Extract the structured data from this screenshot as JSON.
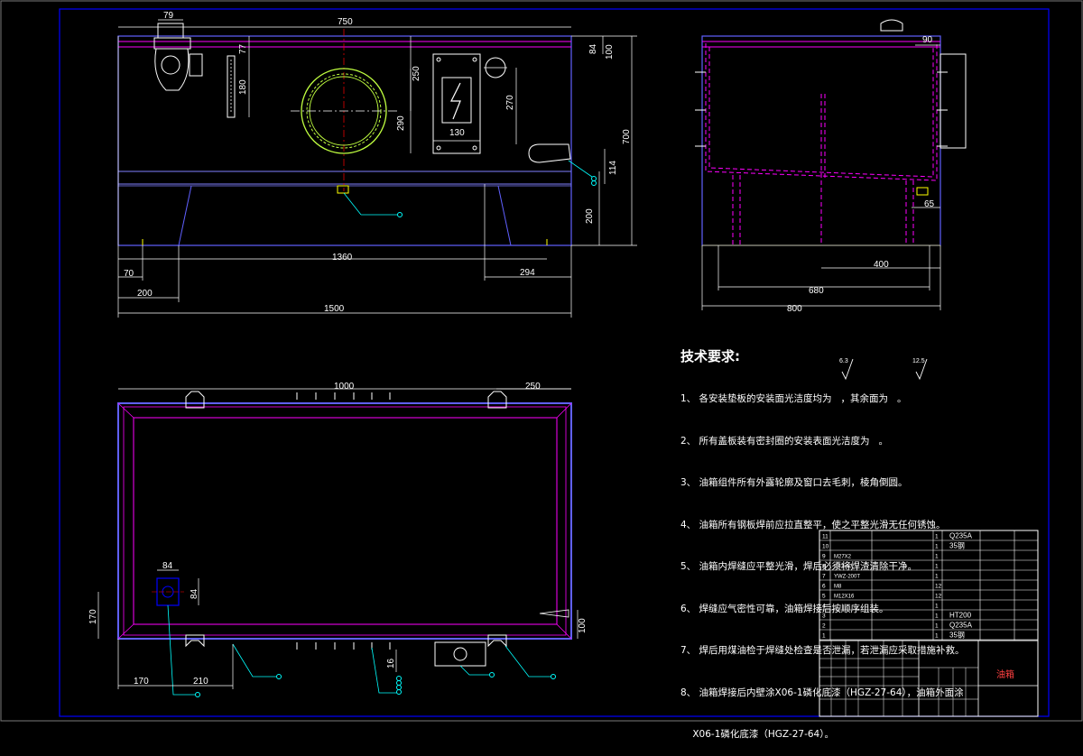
{
  "dimensions": {
    "front": [
      "79",
      "750",
      "84",
      "100",
      "77",
      "250",
      "180",
      "290",
      "270",
      "130",
      "700",
      "114",
      "200",
      "1360",
      "70",
      "294",
      "200",
      "1500"
    ],
    "side": [
      "90",
      "65",
      "400",
      "680",
      "800"
    ],
    "plan": [
      "1000",
      "250",
      "84",
      "84",
      "170",
      "100",
      "170",
      "210",
      "16"
    ]
  },
  "tech": {
    "title": "技术要求:",
    "items": [
      "1、 各安装垫板的安装面光洁度均为   ，其余面为   。",
      "2、 所有盖板装有密封圈的安装表面光洁度为   。",
      "3、 油箱组件所有外露轮廓及窗口去毛刺，棱角倒圆。",
      "4、 油箱所有钢板焊前应拉直整平，使之平整光滑无任何锈蚀。",
      "5、 油箱内焊缝应平整光滑，焊后必须将焊渣清除干净。",
      "6、 焊缝应气密性可靠，油箱焊接后按顺序组装。",
      "7、 焊后用煤油检于焊缝处检查是否泄漏，若泄漏应采取措施补救。",
      "8、 油箱焊接后内壁涂X06-1磷化底漆（HGZ-27-64），油箱外面涂",
      "    X06-1磷化底漆（HGZ-27-64）。"
    ],
    "roughness": [
      "6.3",
      "12.5"
    ]
  },
  "bom": {
    "rows": [
      {
        "no": "11",
        "code": "",
        "name": "",
        "qty": "1",
        "material": "Q235A",
        "note": ""
      },
      {
        "no": "10",
        "code": "",
        "name": "",
        "qty": "1",
        "material": "35钢",
        "note": ""
      },
      {
        "no": "9",
        "code": "M27X2",
        "name": "",
        "qty": "1",
        "material": "",
        "note": ""
      },
      {
        "no": "8",
        "code": "EF3-40",
        "name": "",
        "qty": "1",
        "material": "",
        "note": ""
      },
      {
        "no": "7",
        "code": "YWZ-200T",
        "name": "",
        "qty": "1",
        "material": "",
        "note": ""
      },
      {
        "no": "6",
        "code": "M8",
        "name": "",
        "qty": "12",
        "material": "",
        "note": ""
      },
      {
        "no": "5",
        "code": "M12X16",
        "name": "",
        "qty": "12",
        "material": "",
        "note": ""
      },
      {
        "no": "4",
        "code": "",
        "name": "",
        "qty": "1",
        "material": "",
        "note": ""
      },
      {
        "no": "3",
        "code": "",
        "name": "",
        "qty": "1",
        "material": "HT200",
        "note": ""
      },
      {
        "no": "2",
        "code": "",
        "name": "",
        "qty": "1",
        "material": "Q235A",
        "note": ""
      },
      {
        "no": "1",
        "code": "",
        "name": "",
        "qty": "1",
        "material": "35钢",
        "note": ""
      }
    ],
    "header": [
      "序号",
      "代号",
      "名称",
      "数量",
      "材料",
      "备注"
    ],
    "drawing_title": "油箱"
  },
  "colors": {
    "background": "#000000",
    "outline": "#ffffff",
    "dimension": "#ffffff",
    "hidden": "#ff00ff",
    "frame": "#0000ff",
    "symbol": "#00ffff",
    "accent": "#ffff00",
    "center": "#ff0000",
    "ring": "#c0ff40"
  }
}
